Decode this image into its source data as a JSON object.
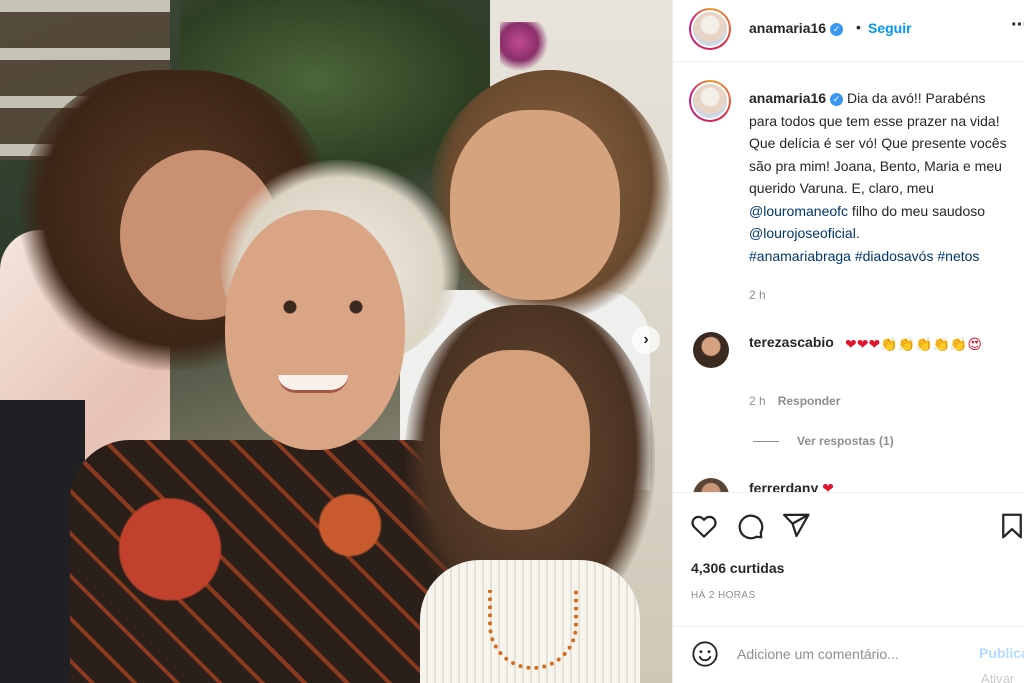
{
  "post": {
    "carousel_next_icon": "chevron-right-icon"
  },
  "header": {
    "username": "anamaria16",
    "verified_icon": "verified-badge-icon",
    "separator": "•",
    "follow_label": "Seguir",
    "more_icon": "more-options-icon",
    "more_glyph": "···"
  },
  "caption": {
    "username": "anamaria16",
    "text_1": "Dia da avó!! Parabéns para todos que tem esse prazer na vida! Que delícia é ser vó! Que presente vocês são pra mim! Joana, Bento, Maria e meu querido Varuna. E, claro, meu ",
    "mention_1": "@louromaneofc",
    "text_2": " filho do meu saudoso ",
    "mention_2": "@lourojoseoficial",
    "text_3": ".",
    "hashtags": [
      "#anamariabraga",
      "#diadosavós",
      "#netos"
    ],
    "time": "2 h"
  },
  "comments": [
    {
      "username": "terezascabio",
      "emojis": "❤❤❤👏👏👏👏👏😍",
      "time": "2 h",
      "reply_label": "Responder",
      "view_replies": "Ver respostas (1)"
    },
    {
      "username": "ferrerdany",
      "emojis": "❤"
    }
  ],
  "actions": {
    "like_icon": "heart-icon",
    "comment_icon": "comment-icon",
    "share_icon": "share-icon",
    "save_icon": "bookmark-icon",
    "likes": "4,306 curtidas",
    "posted": "HÁ 2 HORAS"
  },
  "add_comment": {
    "emoji_icon": "emoji-icon",
    "placeholder": "Adicione um comentário...",
    "post_label": "Publicar",
    "watermark": "Ativar"
  },
  "colors": {
    "link_blue": "#0095f6",
    "mention_blue": "#00376b",
    "heart_red": "#e0142c",
    "muted_gray": "#8e8e8e"
  }
}
